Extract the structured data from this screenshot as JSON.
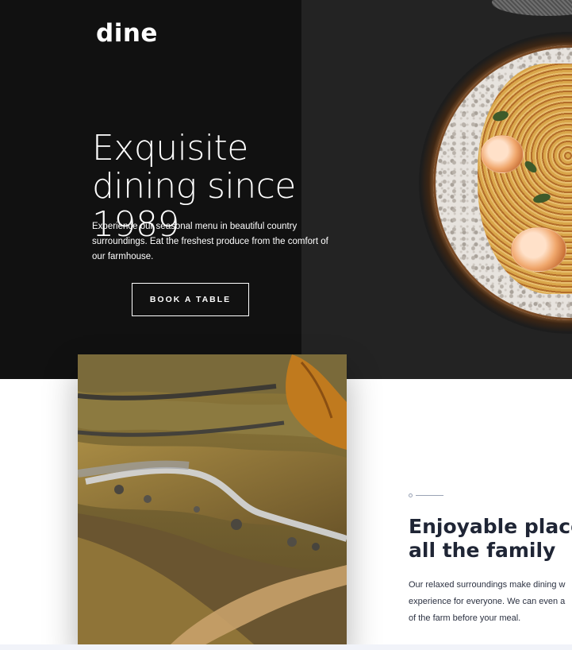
{
  "brand": {
    "logo": "dine"
  },
  "hero": {
    "title": "Exquisite dining since 1989",
    "text": "Experience our seasonal menu in beautiful country surroundings. Eat the freshest produce from the comfort of our farmhouse.",
    "cta_label": "BOOK A TABLE",
    "image_icon": "pasta-plate-image"
  },
  "feature": {
    "image_icon": "farm-landscape-image",
    "title": "Enjoyable place\nall the family",
    "text": "Our relaxed surroundings make dining w\nexperience for everyone. We can even a\nof the farm before your meal."
  },
  "colors": {
    "hero_left": "#111111",
    "hero_right": "#232323",
    "heading_dark": "#1f2535",
    "divider": "#9aa3b5"
  }
}
